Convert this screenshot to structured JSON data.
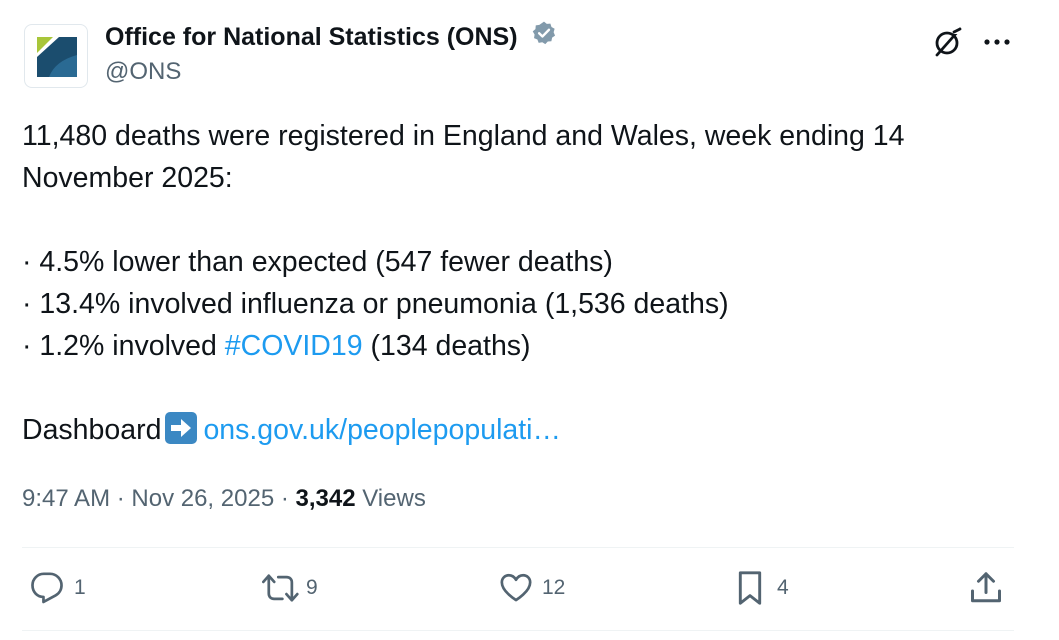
{
  "author": {
    "name": "Office for National Statistics (ONS)",
    "handle": "@ONS",
    "verified": true,
    "badge_color": "#829aab"
  },
  "tweet": {
    "line1": "11,480 deaths were registered in England and Wales, week ending 14",
    "line2": "November 2025:",
    "bullet1": "· 4.5% lower than expected (547 fewer deaths)",
    "bullet2": "· 13.4% involved influenza or pneumonia (1,536 deaths)",
    "bullet3_prefix": "· 1.2% involved ",
    "hashtag": "#COVID19",
    "bullet3_suffix": " (134 deaths)",
    "dashboard_label": "Dashboard",
    "dashboard_emoji": "right-arrow-emoji",
    "dashboard_link": "ons.gov.uk/peoplepopulati…"
  },
  "meta": {
    "time": "9:47 AM",
    "sep1": " · ",
    "date": "Nov 26, 2025",
    "sep2": " · ",
    "views_count": "3,342",
    "views_label": " Views"
  },
  "actions": {
    "replies": "1",
    "reposts": "9",
    "likes": "12",
    "bookmarks": "4"
  },
  "colors": {
    "link": "#1d9bf0",
    "secondary_text": "#536471",
    "primary_text": "#0f1419"
  }
}
